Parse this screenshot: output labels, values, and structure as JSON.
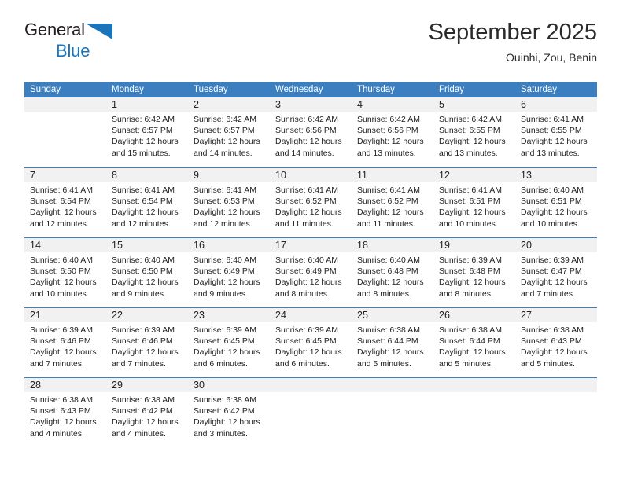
{
  "brand": {
    "line1": "General",
    "line2": "Blue",
    "accent_color": "#1b75bb",
    "text_color": "#231f20"
  },
  "header": {
    "title": "September 2025",
    "location": "Ouinhi, Zou, Benin"
  },
  "calendar": {
    "header_bg": "#3c7fc1",
    "daynum_bg": "#f1f1f1",
    "day_names": [
      "Sunday",
      "Monday",
      "Tuesday",
      "Wednesday",
      "Thursday",
      "Friday",
      "Saturday"
    ],
    "weeks": [
      [
        {
          "day": "",
          "lines": []
        },
        {
          "day": "1",
          "lines": [
            "Sunrise: 6:42 AM",
            "Sunset: 6:57 PM",
            "Daylight: 12 hours",
            "and 15 minutes."
          ]
        },
        {
          "day": "2",
          "lines": [
            "Sunrise: 6:42 AM",
            "Sunset: 6:57 PM",
            "Daylight: 12 hours",
            "and 14 minutes."
          ]
        },
        {
          "day": "3",
          "lines": [
            "Sunrise: 6:42 AM",
            "Sunset: 6:56 PM",
            "Daylight: 12 hours",
            "and 14 minutes."
          ]
        },
        {
          "day": "4",
          "lines": [
            "Sunrise: 6:42 AM",
            "Sunset: 6:56 PM",
            "Daylight: 12 hours",
            "and 13 minutes."
          ]
        },
        {
          "day": "5",
          "lines": [
            "Sunrise: 6:42 AM",
            "Sunset: 6:55 PM",
            "Daylight: 12 hours",
            "and 13 minutes."
          ]
        },
        {
          "day": "6",
          "lines": [
            "Sunrise: 6:41 AM",
            "Sunset: 6:55 PM",
            "Daylight: 12 hours",
            "and 13 minutes."
          ]
        }
      ],
      [
        {
          "day": "7",
          "lines": [
            "Sunrise: 6:41 AM",
            "Sunset: 6:54 PM",
            "Daylight: 12 hours",
            "and 12 minutes."
          ]
        },
        {
          "day": "8",
          "lines": [
            "Sunrise: 6:41 AM",
            "Sunset: 6:54 PM",
            "Daylight: 12 hours",
            "and 12 minutes."
          ]
        },
        {
          "day": "9",
          "lines": [
            "Sunrise: 6:41 AM",
            "Sunset: 6:53 PM",
            "Daylight: 12 hours",
            "and 12 minutes."
          ]
        },
        {
          "day": "10",
          "lines": [
            "Sunrise: 6:41 AM",
            "Sunset: 6:52 PM",
            "Daylight: 12 hours",
            "and 11 minutes."
          ]
        },
        {
          "day": "11",
          "lines": [
            "Sunrise: 6:41 AM",
            "Sunset: 6:52 PM",
            "Daylight: 12 hours",
            "and 11 minutes."
          ]
        },
        {
          "day": "12",
          "lines": [
            "Sunrise: 6:41 AM",
            "Sunset: 6:51 PM",
            "Daylight: 12 hours",
            "and 10 minutes."
          ]
        },
        {
          "day": "13",
          "lines": [
            "Sunrise: 6:40 AM",
            "Sunset: 6:51 PM",
            "Daylight: 12 hours",
            "and 10 minutes."
          ]
        }
      ],
      [
        {
          "day": "14",
          "lines": [
            "Sunrise: 6:40 AM",
            "Sunset: 6:50 PM",
            "Daylight: 12 hours",
            "and 10 minutes."
          ]
        },
        {
          "day": "15",
          "lines": [
            "Sunrise: 6:40 AM",
            "Sunset: 6:50 PM",
            "Daylight: 12 hours",
            "and 9 minutes."
          ]
        },
        {
          "day": "16",
          "lines": [
            "Sunrise: 6:40 AM",
            "Sunset: 6:49 PM",
            "Daylight: 12 hours",
            "and 9 minutes."
          ]
        },
        {
          "day": "17",
          "lines": [
            "Sunrise: 6:40 AM",
            "Sunset: 6:49 PM",
            "Daylight: 12 hours",
            "and 8 minutes."
          ]
        },
        {
          "day": "18",
          "lines": [
            "Sunrise: 6:40 AM",
            "Sunset: 6:48 PM",
            "Daylight: 12 hours",
            "and 8 minutes."
          ]
        },
        {
          "day": "19",
          "lines": [
            "Sunrise: 6:39 AM",
            "Sunset: 6:48 PM",
            "Daylight: 12 hours",
            "and 8 minutes."
          ]
        },
        {
          "day": "20",
          "lines": [
            "Sunrise: 6:39 AM",
            "Sunset: 6:47 PM",
            "Daylight: 12 hours",
            "and 7 minutes."
          ]
        }
      ],
      [
        {
          "day": "21",
          "lines": [
            "Sunrise: 6:39 AM",
            "Sunset: 6:46 PM",
            "Daylight: 12 hours",
            "and 7 minutes."
          ]
        },
        {
          "day": "22",
          "lines": [
            "Sunrise: 6:39 AM",
            "Sunset: 6:46 PM",
            "Daylight: 12 hours",
            "and 7 minutes."
          ]
        },
        {
          "day": "23",
          "lines": [
            "Sunrise: 6:39 AM",
            "Sunset: 6:45 PM",
            "Daylight: 12 hours",
            "and 6 minutes."
          ]
        },
        {
          "day": "24",
          "lines": [
            "Sunrise: 6:39 AM",
            "Sunset: 6:45 PM",
            "Daylight: 12 hours",
            "and 6 minutes."
          ]
        },
        {
          "day": "25",
          "lines": [
            "Sunrise: 6:38 AM",
            "Sunset: 6:44 PM",
            "Daylight: 12 hours",
            "and 5 minutes."
          ]
        },
        {
          "day": "26",
          "lines": [
            "Sunrise: 6:38 AM",
            "Sunset: 6:44 PM",
            "Daylight: 12 hours",
            "and 5 minutes."
          ]
        },
        {
          "day": "27",
          "lines": [
            "Sunrise: 6:38 AM",
            "Sunset: 6:43 PM",
            "Daylight: 12 hours",
            "and 5 minutes."
          ]
        }
      ],
      [
        {
          "day": "28",
          "lines": [
            "Sunrise: 6:38 AM",
            "Sunset: 6:43 PM",
            "Daylight: 12 hours",
            "and 4 minutes."
          ]
        },
        {
          "day": "29",
          "lines": [
            "Sunrise: 6:38 AM",
            "Sunset: 6:42 PM",
            "Daylight: 12 hours",
            "and 4 minutes."
          ]
        },
        {
          "day": "30",
          "lines": [
            "Sunrise: 6:38 AM",
            "Sunset: 6:42 PM",
            "Daylight: 12 hours",
            "and 3 minutes."
          ]
        },
        {
          "day": "",
          "lines": []
        },
        {
          "day": "",
          "lines": []
        },
        {
          "day": "",
          "lines": []
        },
        {
          "day": "",
          "lines": []
        }
      ]
    ]
  }
}
